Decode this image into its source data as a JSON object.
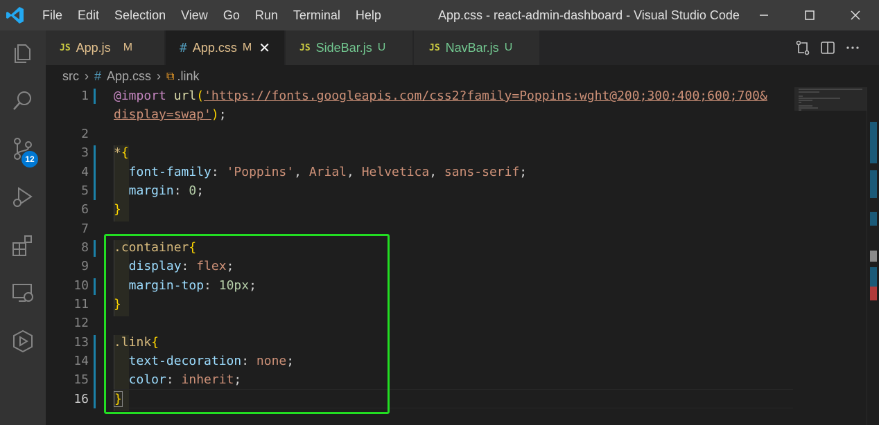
{
  "titlebar": {
    "menu": [
      "File",
      "Edit",
      "Selection",
      "View",
      "Go",
      "Run",
      "Terminal",
      "Help"
    ],
    "window_title": "App.css - react-admin-dashboard - Visual Studio Code",
    "minimize_icon": "minimize-icon",
    "maximize_icon": "maximize-icon",
    "close_icon": "close-icon"
  },
  "activitybar": {
    "items": [
      "explorer-icon",
      "search-icon",
      "source-control-icon",
      "run-debug-icon",
      "extensions-icon",
      "remote-explorer-icon",
      "gitlens-icon"
    ],
    "scm_badge": "12"
  },
  "tabs": [
    {
      "icon": "JS",
      "label": "App.js",
      "status": "M",
      "active": false
    },
    {
      "icon": "#",
      "label": "App.css",
      "status": "M",
      "active": true
    },
    {
      "icon": "JS",
      "label": "SideBar.js",
      "status": "U",
      "active": false
    },
    {
      "icon": "JS",
      "label": "NavBar.js",
      "status": "U",
      "active": false
    }
  ],
  "tab_actions": [
    "compare-changes-icon",
    "split-editor-icon",
    "more-actions-icon"
  ],
  "breadcrumb": {
    "folder": "src",
    "file_icon": "#",
    "file": "App.css",
    "symbol": ".link"
  },
  "editor": {
    "line_numbers": [
      "1",
      "",
      "2",
      "3",
      "4",
      "5",
      "6",
      "7",
      "8",
      "9",
      "10",
      "11",
      "12",
      "13",
      "14",
      "15",
      "16"
    ],
    "current_line": "16",
    "colors": {
      "background": "#1e1e1e",
      "highlight_box": "#22dd22",
      "git_modified_bar": "#1b81a8"
    },
    "code": {
      "l1_a": "@import",
      "l1_b": "url",
      "l1_c": "(",
      "l1_d": "'https://fonts.googleapis.com/css2?family=Poppins:wght@200;300;400;600;700&",
      "l1w_a": "display=swap'",
      "l1w_b": ")",
      "l1w_c": ";",
      "l3_a": "*",
      "l3_b": "{",
      "l4_a": "  font-family",
      "l4_b": ": ",
      "l4_c": "'Poppins'",
      "l4_d": ", ",
      "l4_e": "Arial",
      "l4_f": ", ",
      "l4_g": "Helvetica",
      "l4_h": ", ",
      "l4_i": "sans-serif",
      "l4_j": ";",
      "l5_a": "  margin",
      "l5_b": ": ",
      "l5_c": "0",
      "l5_d": ";",
      "l6": "}",
      "l8_a": ".container",
      "l8_b": "{",
      "l9_a": "  display",
      "l9_b": ": ",
      "l9_c": "flex",
      "l9_d": ";",
      "l10_a": "  margin-top",
      "l10_b": ": ",
      "l10_c": "10px",
      "l10_d": ";",
      "l11": "}",
      "l13_a": ".link",
      "l13_b": "{",
      "l14_a": "  text-decoration",
      "l14_b": ": ",
      "l14_c": "none",
      "l14_d": ";",
      "l15_a": "  color",
      "l15_b": ": ",
      "l15_c": "inherit",
      "l15_d": ";",
      "l16": "}"
    }
  }
}
